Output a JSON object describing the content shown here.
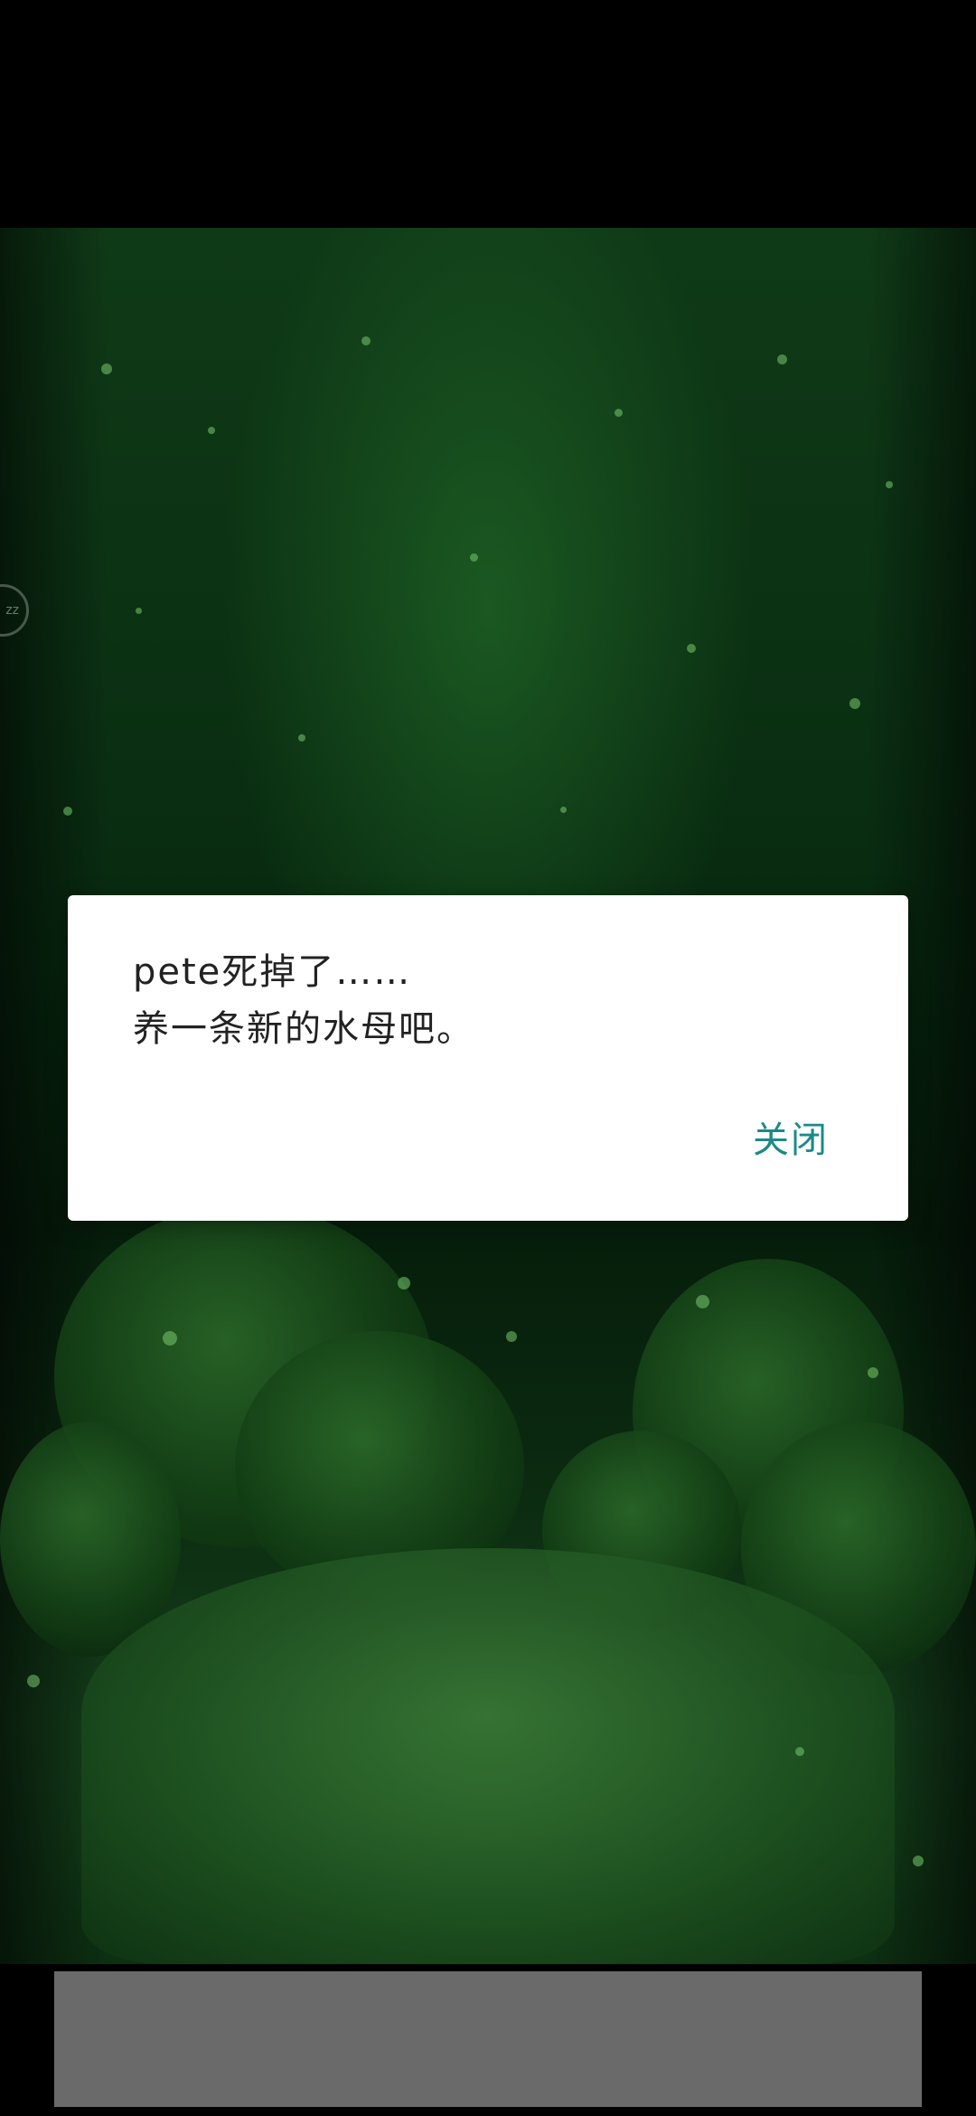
{
  "dialog": {
    "line1": "pete死掉了……",
    "line2": "养一条新的水母吧。",
    "close_label": "关闭"
  },
  "side_button": {
    "label": "zz",
    "icon": "sleep-icon"
  },
  "colors": {
    "accent": "#1b8a86",
    "dialog_bg": "#ffffff",
    "scene_green": "#0c3314",
    "ad_placeholder": "#6a6a6a"
  }
}
